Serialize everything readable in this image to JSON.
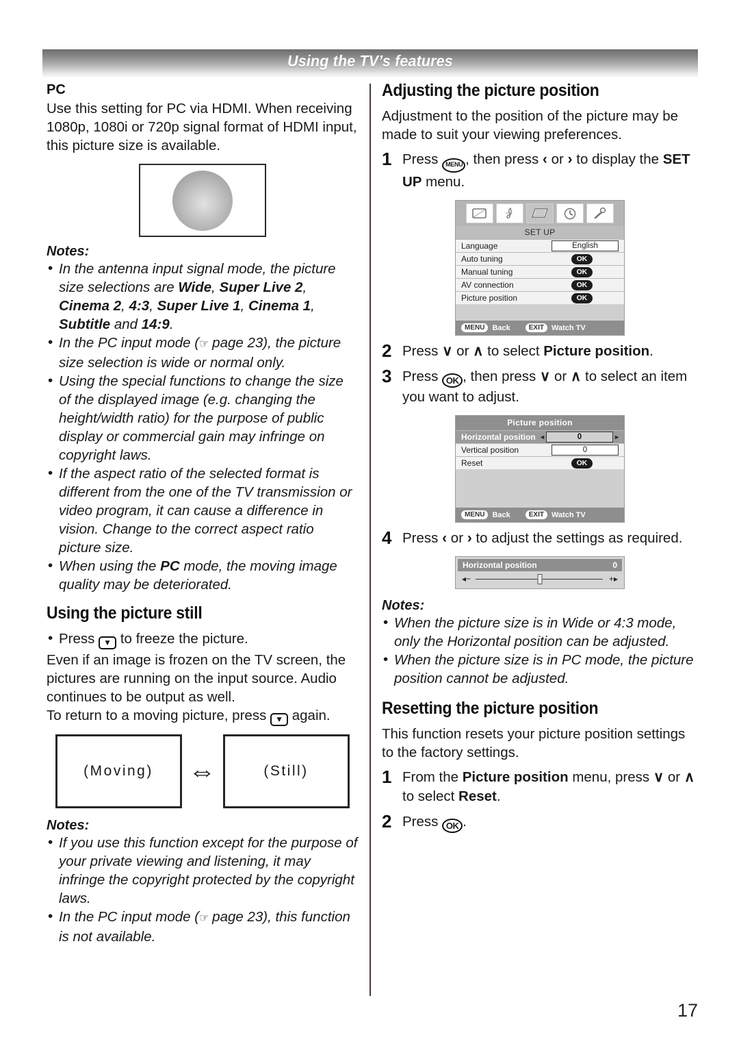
{
  "header": {
    "title": "Using the TV’s features"
  },
  "page_number": "17",
  "left": {
    "pc": {
      "heading": "PC",
      "body": "Use this setting for PC via HDMI. When receiving 1080p, 1080i or 720p signal format of HDMI input, this picture size is available."
    },
    "notes_label": "Notes:",
    "notes": [
      {
        "parts": [
          {
            "t": "In the antenna input signal mode, the picture size selections are ",
            "style": "i"
          },
          {
            "t": "Wide",
            "style": "bi"
          },
          {
            "t": ", ",
            "style": "i"
          },
          {
            "t": "Super Live 2",
            "style": "bi"
          },
          {
            "t": ", ",
            "style": "i"
          },
          {
            "t": "Cinema 2",
            "style": "bi"
          },
          {
            "t": ", ",
            "style": "i"
          },
          {
            "t": "4:3",
            "style": "bi"
          },
          {
            "t": ", ",
            "style": "i"
          },
          {
            "t": "Super Live 1",
            "style": "bi"
          },
          {
            "t": ", ",
            "style": "i"
          },
          {
            "t": "Cinema 1",
            "style": "bi"
          },
          {
            "t": ", ",
            "style": "i"
          },
          {
            "t": "Subtitle",
            "style": "bi"
          },
          {
            "t": " and ",
            "style": "i"
          },
          {
            "t": "14:9",
            "style": "bi"
          },
          {
            "t": ".",
            "style": "i"
          }
        ]
      },
      {
        "parts": [
          {
            "t": "In the PC input mode (",
            "style": "i"
          },
          {
            "t": "☞",
            "style": "hand"
          },
          {
            "t": " page 23), the picture size selection is wide or normal only.",
            "style": "i"
          }
        ]
      },
      {
        "parts": [
          {
            "t": "Using the special functions to change the size of the displayed image (e.g. changing the height/width ratio) for the purpose of public display or commercial gain may infringe on copyright laws.",
            "style": "i"
          }
        ]
      },
      {
        "parts": [
          {
            "t": "If the aspect ratio of the selected format is different from the one of the TV transmission or video program, it can cause a difference in vision. Change to the correct aspect ratio picture size.",
            "style": "i"
          }
        ]
      },
      {
        "parts": [
          {
            "t": "When using the ",
            "style": "i"
          },
          {
            "t": "PC",
            "style": "bi"
          },
          {
            "t": " mode, the moving image quality may be deteriorated.",
            "style": "i"
          }
        ]
      }
    ],
    "still": {
      "heading": "Using the picture still",
      "bullet_prefix": "Press",
      "bullet_suffix": "to freeze the picture.",
      "para1": "Even if an image is frozen on the TV screen, the pictures are running on the input source. Audio continues to be output as well.",
      "para2_prefix": "To return to a moving picture, press",
      "para2_suffix": "again.",
      "figure": {
        "left_label": "(Moving)",
        "right_label": "(Still)",
        "arrow": "⇔"
      }
    },
    "notes2_label": "Notes:",
    "notes2": [
      {
        "parts": [
          {
            "t": "If you use this function except for the purpose of your private viewing and listening, it may infringe the copyright protected by the copyright laws.",
            "style": "i"
          }
        ]
      },
      {
        "parts": [
          {
            "t": "In the PC input mode (",
            "style": "i"
          },
          {
            "t": "☞",
            "style": "hand"
          },
          {
            "t": " page 23), this function is not available.",
            "style": "i"
          }
        ]
      }
    ]
  },
  "right": {
    "adjusting": {
      "heading": "Adjusting the picture position",
      "intro": "Adjustment to the position of the picture may be made to suit your viewing preferences.",
      "steps": [
        {
          "num": "1",
          "parts": [
            {
              "t": "Press ",
              "style": "n"
            },
            {
              "t": "MENU",
              "style": "key-menu"
            },
            {
              "t": ", then press ",
              "style": "n"
            },
            {
              "t": "‹",
              "style": "chev"
            },
            {
              "t": " or ",
              "style": "n"
            },
            {
              "t": "›",
              "style": "chev"
            },
            {
              "t": " to display the ",
              "style": "n"
            },
            {
              "t": "SET UP",
              "style": "b"
            },
            {
              "t": " menu.",
              "style": "n"
            }
          ]
        },
        {
          "num": "2",
          "parts": [
            {
              "t": "Press ",
              "style": "n"
            },
            {
              "t": "∨",
              "style": "chev"
            },
            {
              "t": " or ",
              "style": "n"
            },
            {
              "t": "∧",
              "style": "chev"
            },
            {
              "t": " to select ",
              "style": "n"
            },
            {
              "t": "Picture position",
              "style": "b"
            },
            {
              "t": ".",
              "style": "n"
            }
          ]
        },
        {
          "num": "3",
          "parts": [
            {
              "t": "Press ",
              "style": "n"
            },
            {
              "t": "OK",
              "style": "key-ok"
            },
            {
              "t": ", then press ",
              "style": "n"
            },
            {
              "t": "∨",
              "style": "chev"
            },
            {
              "t": " or ",
              "style": "n"
            },
            {
              "t": "∧",
              "style": "chev"
            },
            {
              "t": " to select an item you want to adjust.",
              "style": "n"
            }
          ]
        },
        {
          "num": "4",
          "parts": [
            {
              "t": "Press ",
              "style": "n"
            },
            {
              "t": "‹",
              "style": "chev"
            },
            {
              "t": " or ",
              "style": "n"
            },
            {
              "t": "›",
              "style": "chev"
            },
            {
              "t": " to adjust the settings as required.",
              "style": "n"
            }
          ]
        }
      ]
    },
    "setup_menu": {
      "icons": [
        "picture-icon",
        "audio-note-icon",
        "setup-document-icon",
        "clock-icon",
        "wrench-icon"
      ],
      "active_icon_index": 2,
      "title": "SET UP",
      "rows": [
        {
          "label": "Language",
          "value": "English",
          "type": "box"
        },
        {
          "label": "Auto tuning",
          "value": "OK",
          "type": "ok"
        },
        {
          "label": "Manual tuning",
          "value": "OK",
          "type": "ok"
        },
        {
          "label": "AV connection",
          "value": "OK",
          "type": "ok"
        },
        {
          "label": "Picture position",
          "value": "OK",
          "type": "ok"
        }
      ],
      "footer": {
        "menu_key": "MENU",
        "menu_action": "Back",
        "exit_key": "EXIT",
        "exit_action": "Watch TV"
      }
    },
    "picture_position_menu": {
      "title": "Picture position",
      "rows": [
        {
          "label": "Horizontal position",
          "value": "0",
          "type": "slider",
          "highlighted": true
        },
        {
          "label": "Vertical position",
          "value": "0",
          "type": "box",
          "highlighted": false
        },
        {
          "label": "Reset",
          "value": "OK",
          "type": "ok",
          "highlighted": false
        }
      ],
      "footer": {
        "menu_key": "MENU",
        "menu_action": "Back",
        "exit_key": "EXIT",
        "exit_action": "Watch TV"
      }
    },
    "slider_osd": {
      "label": "Horizontal position",
      "value": "0",
      "minus": "◂−",
      "plus": "+▸"
    },
    "notes_label": "Notes:",
    "notes": [
      {
        "parts": [
          {
            "t": "When the picture size is in Wide or 4:3 mode, only the Horizontal position can be adjusted.",
            "style": "i"
          }
        ]
      },
      {
        "parts": [
          {
            "t": "When the picture size is in PC mode, the picture position cannot be adjusted.",
            "style": "i"
          }
        ]
      }
    ],
    "resetting": {
      "heading": "Resetting the picture position",
      "intro": "This function resets your picture position settings to the factory settings.",
      "steps": [
        {
          "num": "1",
          "parts": [
            {
              "t": "From the ",
              "style": "n"
            },
            {
              "t": "Picture position",
              "style": "b"
            },
            {
              "t": " menu, press ",
              "style": "n"
            },
            {
              "t": "∨",
              "style": "chev"
            },
            {
              "t": " or ",
              "style": "n"
            },
            {
              "t": "∧",
              "style": "chev"
            },
            {
              "t": " to select ",
              "style": "n"
            },
            {
              "t": "Reset",
              "style": "b"
            },
            {
              "t": ".",
              "style": "n"
            }
          ]
        },
        {
          "num": "2",
          "parts": [
            {
              "t": "Press ",
              "style": "n"
            },
            {
              "t": "OK",
              "style": "key-ok"
            },
            {
              "t": ".",
              "style": "n"
            }
          ]
        }
      ]
    }
  }
}
